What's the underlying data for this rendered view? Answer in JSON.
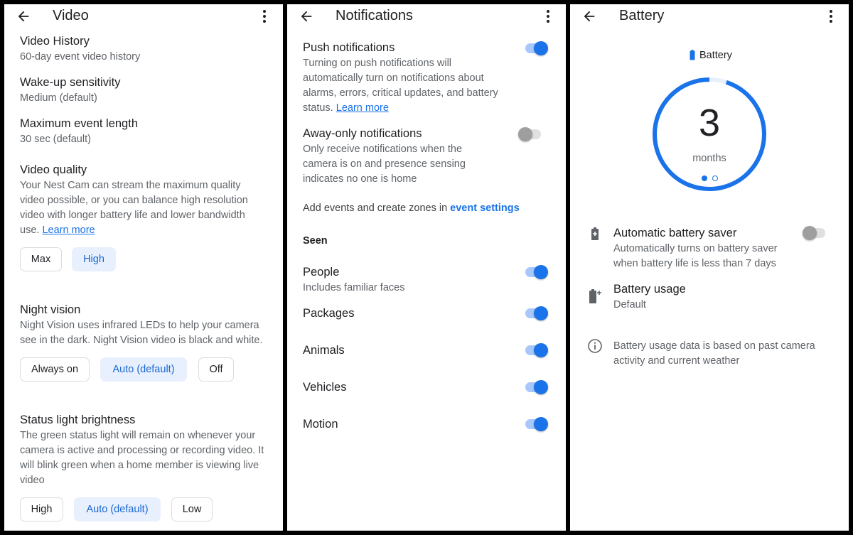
{
  "video": {
    "title": "Video",
    "history": {
      "title": "Video History",
      "sub": "60-day event video history"
    },
    "wake": {
      "title": "Wake-up sensitivity",
      "sub": "Medium (default)"
    },
    "max_event": {
      "title": "Maximum event length",
      "sub": "30 sec (default)"
    },
    "quality": {
      "title": "Video quality",
      "desc_lines": [
        "Your Nest Cam can stream the maximum quality",
        "video possible, or you can balance high resolution",
        "video with longer battery life and lower bandwidth"
      ],
      "desc_last": "use.",
      "learn_more": "Learn more",
      "options": [
        "Max",
        "High"
      ],
      "selected": "High"
    },
    "night": {
      "title": "Night vision",
      "desc_lines": [
        "Night Vision uses infrared LEDs to help your camera",
        "see in the dark. Night Vision video is black and white."
      ],
      "options": [
        "Always on",
        "Auto (default)",
        "Off"
      ],
      "selected": "Auto (default)"
    },
    "status_light": {
      "title": "Status light brightness",
      "desc_lines": [
        "The green status light will remain on whenever your",
        "camera is active and processing or recording video. It",
        "will blink green when a home member is viewing live",
        "video"
      ],
      "options": [
        "High",
        "Auto (default)",
        "Low"
      ],
      "selected": "Auto (default)"
    }
  },
  "notifications": {
    "title": "Notifications",
    "push": {
      "title": "Push notifications",
      "desc_lines": [
        "Turning on push notifications will",
        "automatically turn on notifications about",
        "alarms, errors, critical updates, and battery"
      ],
      "desc_last": "status.",
      "learn_more": "Learn more",
      "on": true
    },
    "away": {
      "title": "Away-only notifications",
      "desc_lines": [
        "Only receive notifications when the",
        "camera is on and presence sensing",
        "indicates no one is home"
      ],
      "on": false
    },
    "events_text": "Add events and create zones in",
    "events_link": "event settings",
    "seen_header": "Seen",
    "people": {
      "title": "People",
      "sub": "Includes familiar faces",
      "on": true
    },
    "packages": {
      "title": "Packages",
      "on": true
    },
    "animals": {
      "title": "Animals",
      "on": true
    },
    "vehicles": {
      "title": "Vehicles",
      "on": true
    },
    "motion": {
      "title": "Motion",
      "on": true
    }
  },
  "battery": {
    "title": "Battery",
    "gauge_label": "Battery",
    "value": "3",
    "unit": "months",
    "gauge_fill_fraction": 0.95,
    "saver": {
      "title": "Automatic battery saver",
      "desc_lines": [
        "Automatically turns on battery saver",
        "when battery life is less than 7 days"
      ],
      "on": false
    },
    "usage": {
      "title": "Battery usage",
      "sub": "Default"
    },
    "info_lines": [
      "Battery usage data is based on past camera",
      "activity and current weather"
    ]
  },
  "colors": {
    "accent": "#1a73e8",
    "chip_selected_bg": "#e8f0fe",
    "text": "#202124",
    "secondary": "#5f6368"
  }
}
